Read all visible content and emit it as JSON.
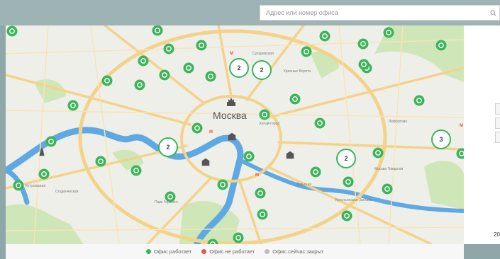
{
  "search": {
    "placeholder": "Адрес или номер офиса"
  },
  "map": {
    "city_label": "Москва",
    "district_labels": [
      {
        "text": "Сухаревская"
      },
      {
        "text": "Красные Ворота"
      },
      {
        "text": "Китай-город"
      },
      {
        "text": "Кутузовская"
      },
      {
        "text": "Студенческая"
      },
      {
        "text": "Тульская"
      },
      {
        "text": "Крестьянская Застава"
      },
      {
        "text": "Лефортово"
      },
      {
        "text": "Москва Товарная"
      },
      {
        "text": "Парк Горького"
      }
    ],
    "clusters": [
      {
        "count": "2"
      },
      {
        "count": "2"
      },
      {
        "count": "2"
      },
      {
        "count": "2"
      },
      {
        "count": "3"
      }
    ]
  },
  "right_panel": {
    "text": "20"
  },
  "legend": {
    "items": [
      {
        "label": "Офис работает",
        "color": "#3bb45a"
      },
      {
        "label": "Офис не работает",
        "color": "#e2594c"
      },
      {
        "label": "Офис сейчас закрыт",
        "color": "#bdbdbd"
      }
    ]
  },
  "colors": {
    "marker_green": "#3bb45a",
    "river": "#5ea9e3",
    "roads": "#f3d28a",
    "park": "#cfe7b8"
  }
}
